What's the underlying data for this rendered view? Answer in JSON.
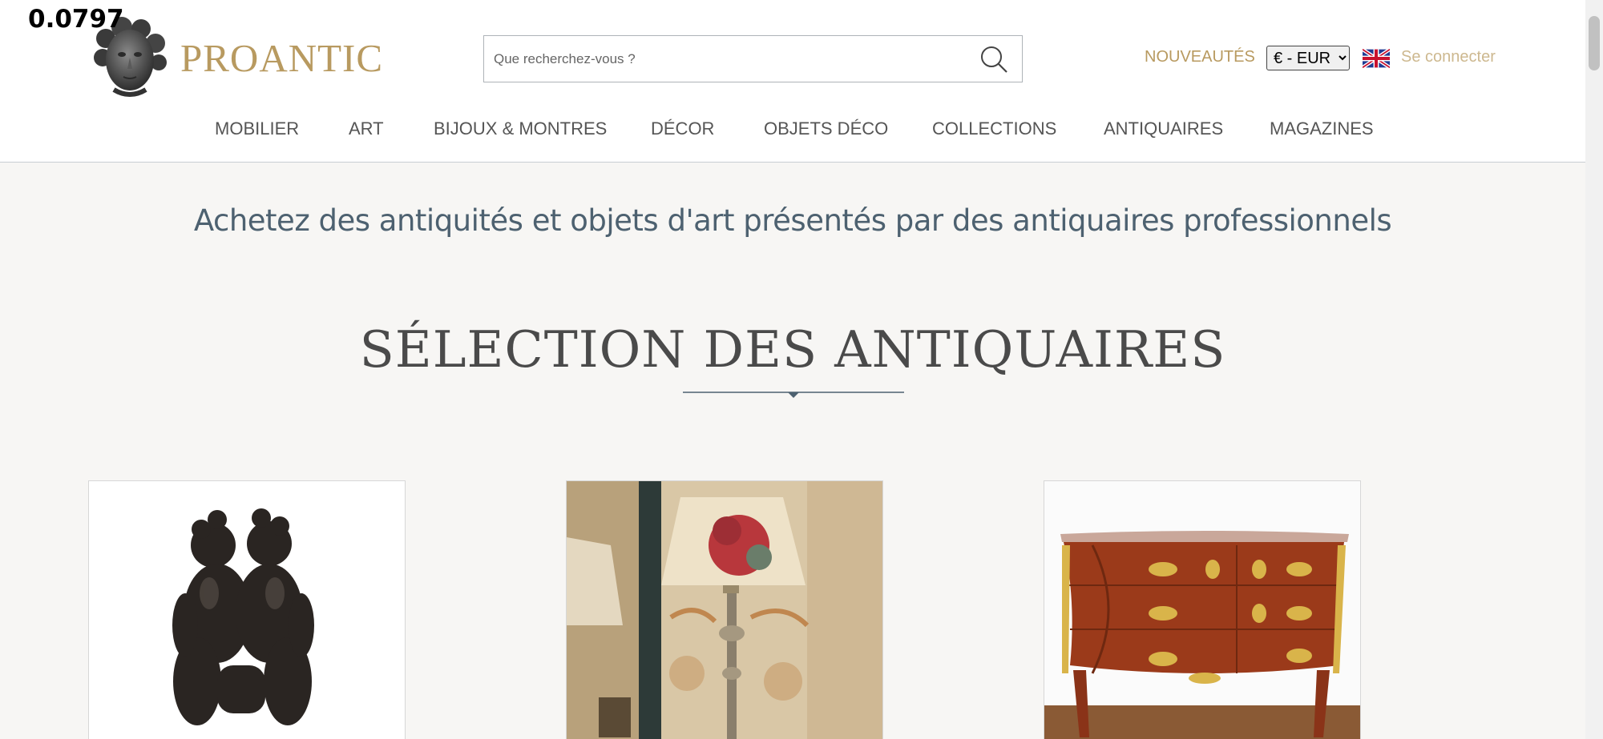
{
  "overlay": {
    "value": "0.0797"
  },
  "brand": {
    "name": "PROANTIC"
  },
  "search": {
    "placeholder": "Que recherchez-vous ?"
  },
  "header": {
    "new_label": "NOUVEAUTÉS",
    "currency_selected": "€ - EUR",
    "login_label": "Se connecter"
  },
  "nav": {
    "items": [
      {
        "label": "MOBILIER"
      },
      {
        "label": "ART"
      },
      {
        "label": "BIJOUX & MONTRES"
      },
      {
        "label": "DÉCOR"
      },
      {
        "label": "OBJETS DÉCO"
      },
      {
        "label": "COLLECTIONS"
      },
      {
        "label": "ANTIQUAIRES"
      },
      {
        "label": "MAGAZINES"
      }
    ]
  },
  "main": {
    "tagline": "Achetez des antiquités et objets d'art présentés par des antiquaires professionnels",
    "section_title": "SÉLECTION DES ANTIQUAIRES"
  },
  "colors": {
    "brand_gold": "#b89a60",
    "login_gold": "#cdb88f",
    "tagline_blue": "#4d6170",
    "page_bg": "#f7f6f4"
  }
}
